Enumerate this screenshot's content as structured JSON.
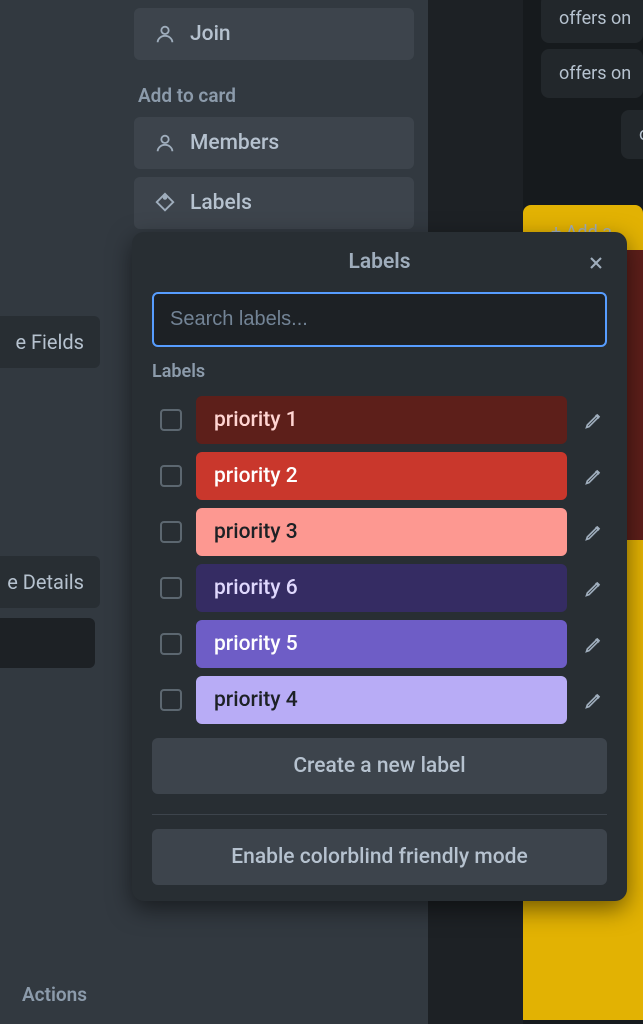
{
  "sidebar": {
    "join": "Join",
    "add_to_card_title": "Add to card",
    "members": "Members",
    "labels": "Labels",
    "actions_title": "Actions",
    "partial_fields": "e Fields",
    "partial_details": "e Details"
  },
  "popover": {
    "title": "Labels",
    "search_placeholder": "Search labels...",
    "section_title": "Labels",
    "create_label": "Create a new label",
    "colorblind": "Enable colorblind friendly mode",
    "labels": [
      {
        "name": "priority 1",
        "bg": "#5d1f1a",
        "fg": "#ffd5d2"
      },
      {
        "name": "priority 2",
        "bg": "#c9372c",
        "fg": "#ffffff"
      },
      {
        "name": "priority 3",
        "bg": "#fd9891",
        "fg": "#1d2125"
      },
      {
        "name": "priority 6",
        "bg": "#352c63",
        "fg": "#dfd8fd"
      },
      {
        "name": "priority 5",
        "bg": "#6e5dc6",
        "fg": "#ffffff"
      },
      {
        "name": "priority 4",
        "bg": "#b8acf6",
        "fg": "#1d2125"
      }
    ]
  },
  "bg": {
    "card_text": "offers on",
    "add_text": "+ Add a"
  }
}
